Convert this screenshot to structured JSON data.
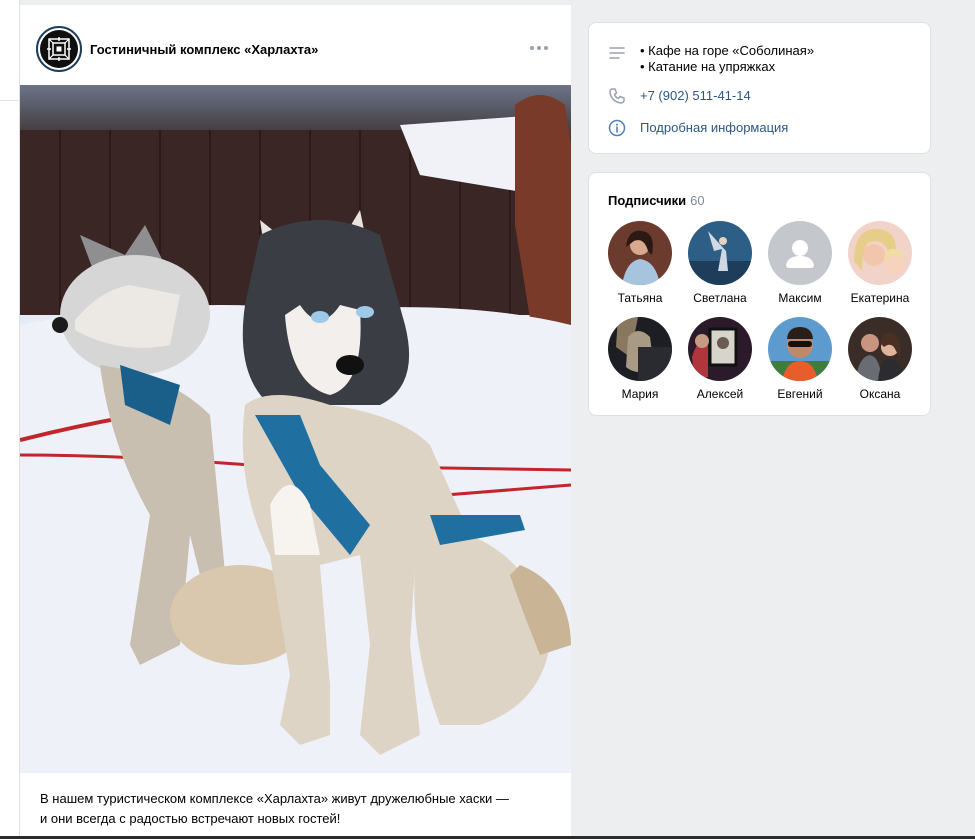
{
  "post": {
    "group_name": "Гостиничный комплекс «Харлахта»",
    "avatar_icon": "ornament-logo",
    "more_icon": "more-dots-icon",
    "text_line1": "В нашем туристическом комплексе «Харлахта» живут дружелюбные хаски —",
    "text_line2": "и они всегда с радостью встречают новых гостей!"
  },
  "info": {
    "desc_line1": "• Кафе на горе «Соболиная»",
    "desc_line2": "• Катание на упряжках",
    "phone": "+7 (902) 511-41-14",
    "details_link": "Подробная информация"
  },
  "subscribers": {
    "title": "Подписчики",
    "count": "60",
    "people": [
      {
        "name": "Татьяна"
      },
      {
        "name": "Светлана"
      },
      {
        "name": "Максим"
      },
      {
        "name": "Екатерина"
      },
      {
        "name": "Мария"
      },
      {
        "name": "Алексей"
      },
      {
        "name": "Евгений"
      },
      {
        "name": "Оксана"
      }
    ]
  },
  "colors": {
    "link": "#2a5885",
    "icon": "#99a2ad",
    "background": "#edeef0"
  }
}
